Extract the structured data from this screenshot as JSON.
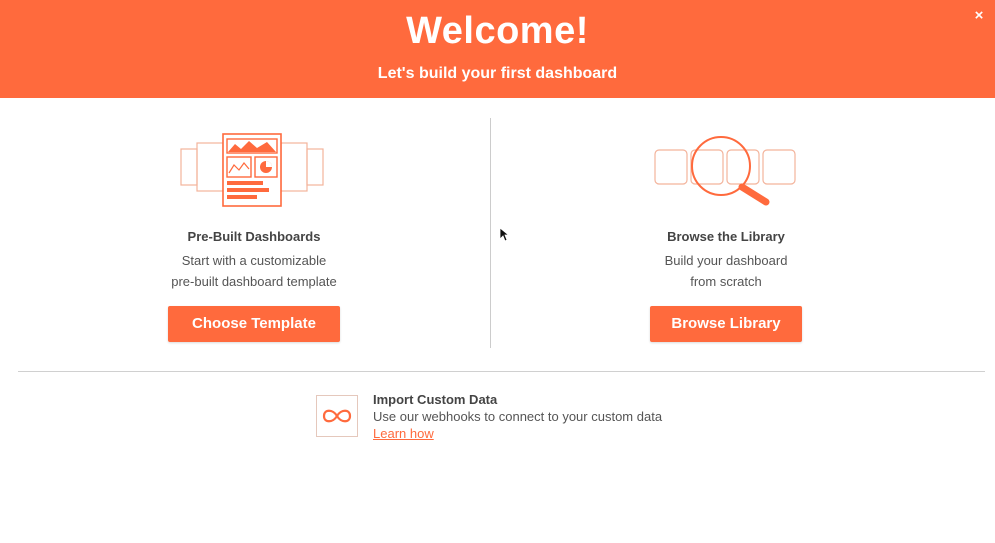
{
  "header": {
    "title": "Welcome!",
    "subtitle": "Let's build your first dashboard",
    "close_label": "×"
  },
  "prebuilt": {
    "heading": "Pre-Built Dashboards",
    "desc_line1": "Start with a customizable",
    "desc_line2": "pre-built dashboard template",
    "button_label": "Choose Template",
    "icon": "dashboard-template-icon"
  },
  "library": {
    "heading": "Browse the Library",
    "desc_line1": "Build your dashboard",
    "desc_line2": "from scratch",
    "button_label": "Browse Library",
    "icon": "magnifier-icon"
  },
  "import": {
    "title": "Import Custom Data",
    "desc": "Use our webhooks to connect to your custom data",
    "link_label": "Learn how",
    "icon": "infinity-icon"
  },
  "colors": {
    "accent": "#ff6a3d",
    "text": "#555555",
    "divider": "#cccccc"
  }
}
